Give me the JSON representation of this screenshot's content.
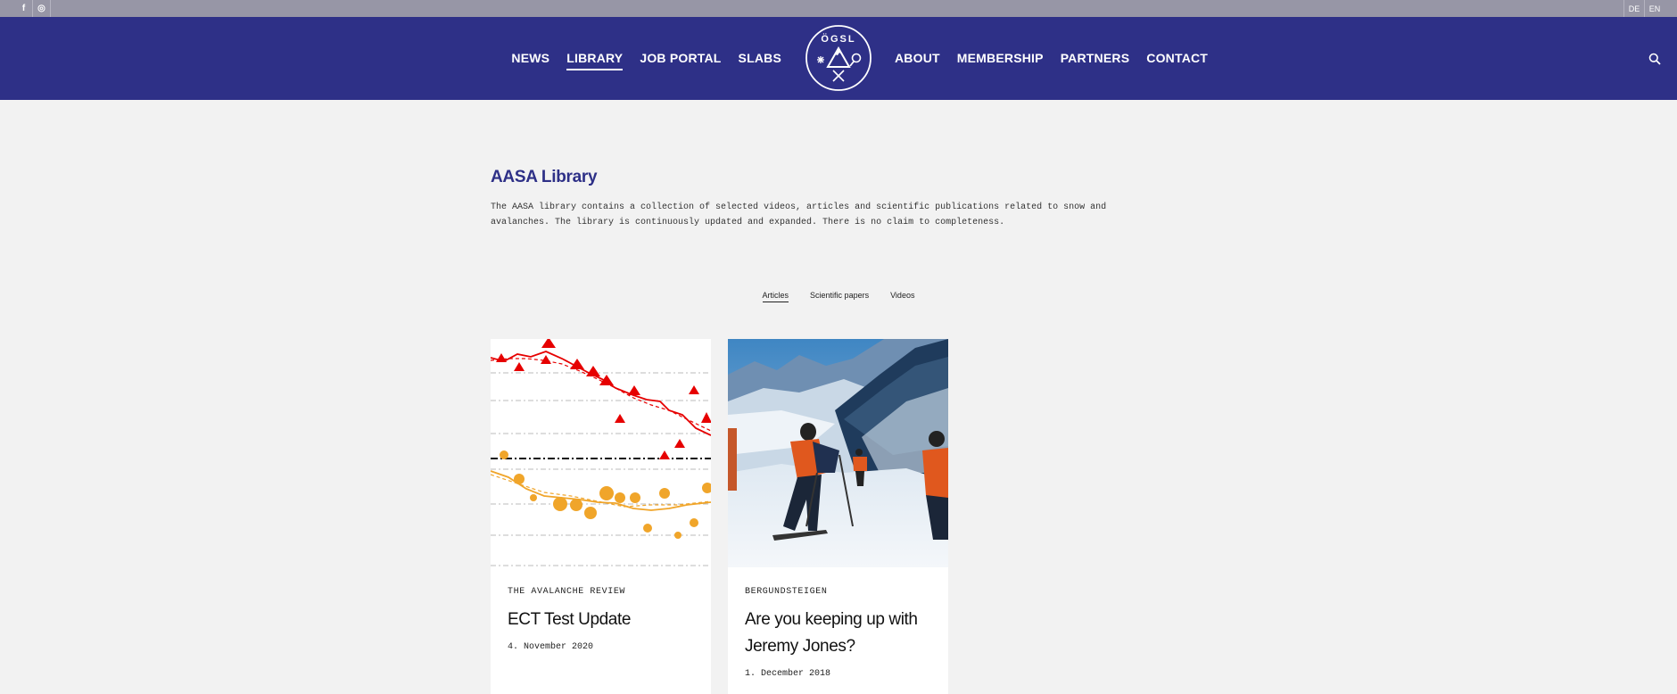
{
  "topbar": {
    "social": [
      {
        "icon": "facebook-icon",
        "glyph": "f"
      },
      {
        "icon": "instagram-icon",
        "glyph": "◎"
      }
    ],
    "languages": [
      "DE",
      "EN"
    ]
  },
  "nav": {
    "left": [
      "NEWS",
      "LIBRARY",
      "JOB PORTAL",
      "SLABS"
    ],
    "right": [
      "ABOUT",
      "MEMBERSHIP",
      "PARTNERS",
      "CONTACT"
    ],
    "active": "LIBRARY",
    "logo_text": "ÖGSL",
    "colors": {
      "navbar": "#2e3087",
      "topbar": "#9796a6"
    }
  },
  "library": {
    "title": "AASA Library",
    "description": "The AASA library contains a collection of selected videos, articles and scientific publications related to snow and avalanches. The library is continuously updated and expanded. There is no claim to completeness."
  },
  "filters": {
    "items": [
      "Articles",
      "Scientific papers",
      "Videos"
    ],
    "active": "Articles"
  },
  "cards": [
    {
      "source": "THE AVALANCHE REVIEW",
      "title": "ECT Test Update",
      "date": "4. November 2020",
      "image": "chart-thumbnail"
    },
    {
      "source": "BERGUNDSTEIGEN",
      "title": "Are you keeping up with Jeremy Jones?",
      "date": "1. December 2018",
      "image": "ski-touring-photo"
    }
  ]
}
